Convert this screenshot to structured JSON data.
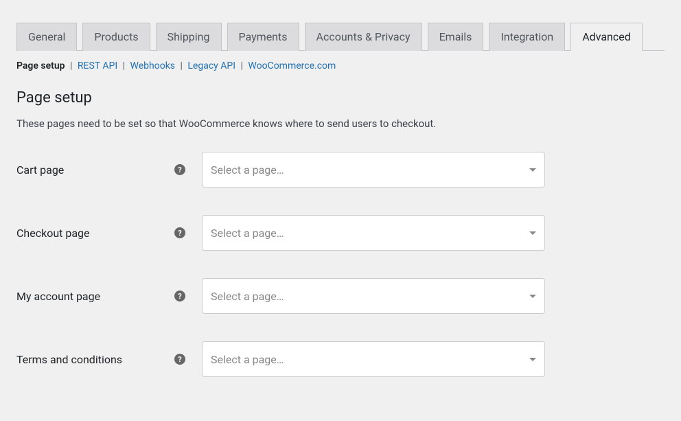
{
  "tabs": [
    {
      "label": "General",
      "active": false
    },
    {
      "label": "Products",
      "active": false
    },
    {
      "label": "Shipping",
      "active": false
    },
    {
      "label": "Payments",
      "active": false
    },
    {
      "label": "Accounts & Privacy",
      "active": false
    },
    {
      "label": "Emails",
      "active": false
    },
    {
      "label": "Integration",
      "active": false
    },
    {
      "label": "Advanced",
      "active": true
    }
  ],
  "sub_nav": [
    {
      "label": "Page setup",
      "active": true
    },
    {
      "label": "REST API",
      "active": false
    },
    {
      "label": "Webhooks",
      "active": false
    },
    {
      "label": "Legacy API",
      "active": false
    },
    {
      "label": "WooCommerce.com",
      "active": false
    }
  ],
  "section": {
    "heading": "Page setup",
    "description": "These pages need to be set so that WooCommerce knows where to send users to checkout."
  },
  "fields": [
    {
      "label": "Cart page",
      "placeholder": "Select a page…"
    },
    {
      "label": "Checkout page",
      "placeholder": "Select a page…"
    },
    {
      "label": "My account page",
      "placeholder": "Select a page…"
    },
    {
      "label": "Terms and conditions",
      "placeholder": "Select a page…"
    }
  ],
  "help_char": "?"
}
